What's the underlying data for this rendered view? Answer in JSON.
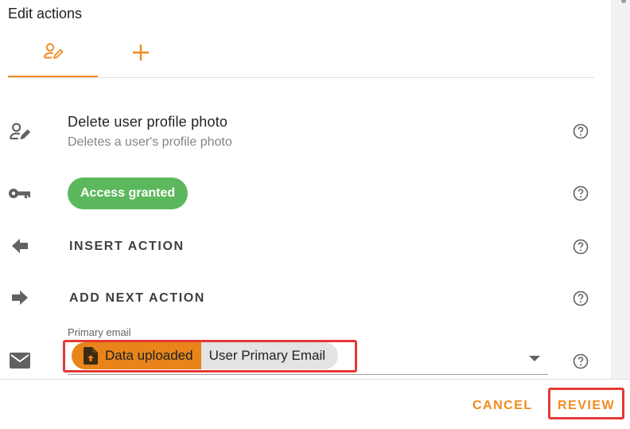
{
  "header": {
    "title": "Edit actions"
  },
  "tabs": [
    {
      "icon": "user-edit-icon",
      "active": true
    },
    {
      "icon": "plus-icon",
      "active": false
    }
  ],
  "action": {
    "title": "Delete user profile photo",
    "subtitle": "Deletes a user's profile photo",
    "icon": "user-edit-icon"
  },
  "access": {
    "label": "Access granted",
    "icon": "key-icon",
    "color": "#5cb85c"
  },
  "insert_action": {
    "label": "INSERT ACTION",
    "icon": "arrow-left-icon"
  },
  "add_next_action": {
    "label": "ADD NEXT ACTION",
    "icon": "arrow-right-icon"
  },
  "email_field": {
    "label": "Primary email",
    "icon": "mail-icon",
    "chip_type_label": "Data uploaded",
    "chip_type_icon": "file-upload-icon",
    "chip_value": "User Primary Email",
    "chip_type_color": "#e8841a"
  },
  "footer": {
    "cancel_label": "CANCEL",
    "review_label": "REVIEW",
    "accent": "#f28b1e"
  },
  "highlight_color": "#e53935"
}
